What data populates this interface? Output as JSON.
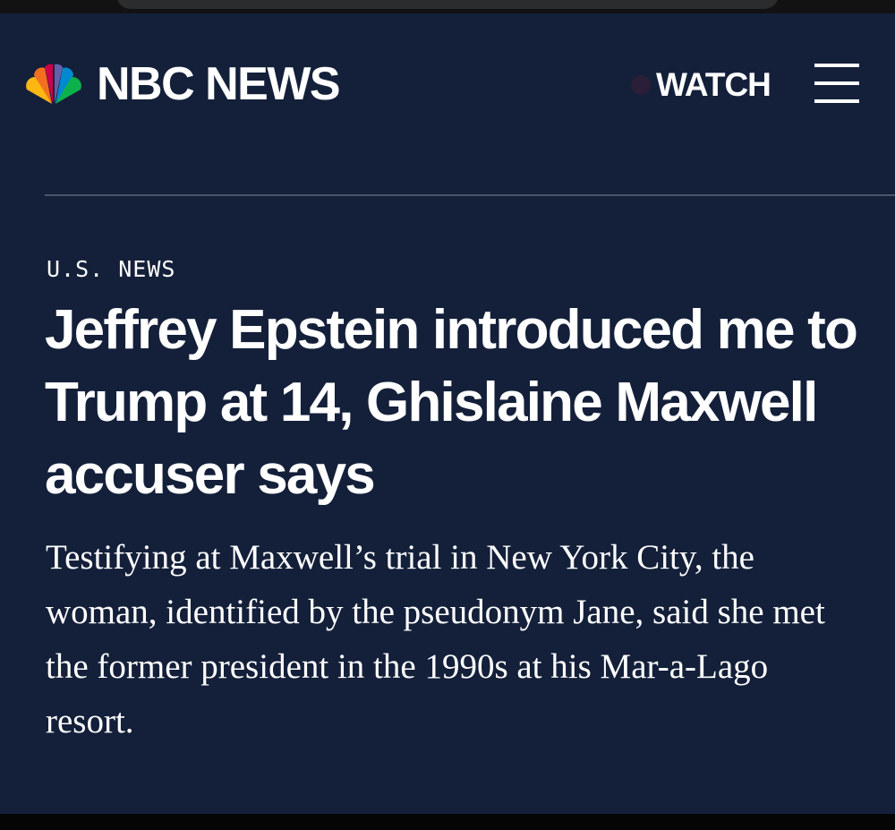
{
  "brand": {
    "name": "NBC NEWS",
    "peacock_colors": [
      "#fcb711",
      "#f37021",
      "#cc004c",
      "#6460aa",
      "#0089d0",
      "#0db14b"
    ]
  },
  "header": {
    "watch_label": "WATCH",
    "menu_icon": "hamburger-menu-icon"
  },
  "article": {
    "section": "U.S. NEWS",
    "headline": "Jeffrey Epstein introduced me to Trump at 14, Ghislaine Maxwell accuser says",
    "dek": "Testifying at Maxwell’s trial in New York City, the woman, identified by the pseudonym Jane, said she met the former president in the 1990s at his Mar-a-Lago resort."
  },
  "colors": {
    "background": "#14203a",
    "text": "#ffffff",
    "divider": "#4a5568"
  }
}
